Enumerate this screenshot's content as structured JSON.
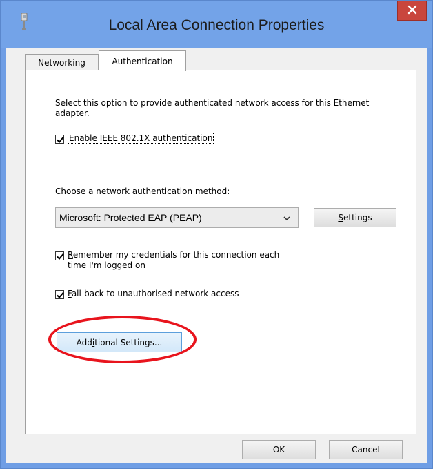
{
  "window": {
    "title": "Local Area Connection Properties",
    "close_icon": "close-icon",
    "title_icon": "network-adapter-icon"
  },
  "tabs": [
    {
      "label": "Networking",
      "selected": false
    },
    {
      "label": "Authentication",
      "selected": true
    }
  ],
  "auth": {
    "description": "Select this option to provide authenticated network access for this Ethernet adapter.",
    "enable_8021x": {
      "pre": "",
      "mnemonic": "E",
      "post": "nable IEEE 802.1X authentication",
      "checked": true
    },
    "method_label": {
      "pre": "Choose a network authentication ",
      "mnemonic": "m",
      "post": "ethod:"
    },
    "method_select": {
      "value": "Microsoft: Protected EAP (PEAP)"
    },
    "settings_button": {
      "pre": "",
      "mnemonic": "S",
      "post": "ettings"
    },
    "remember": {
      "pre": "",
      "mnemonic": "R",
      "post": "emember my credentials for this connection each",
      "line2": "time I'm logged on",
      "checked": true
    },
    "fallback": {
      "pre": "",
      "mnemonic": "F",
      "post": "all-back to unauthorised network access",
      "checked": true
    },
    "additional_button": {
      "pre": "Add",
      "mnemonic": "i",
      "post": "tional Settings..."
    }
  },
  "footer": {
    "ok_label": "OK",
    "cancel_label": "Cancel"
  },
  "colors": {
    "titlebar": "#73a3e8",
    "close_button": "#c9463d",
    "annotation": "#e8141d",
    "focus_button": "#5c9fdc"
  }
}
